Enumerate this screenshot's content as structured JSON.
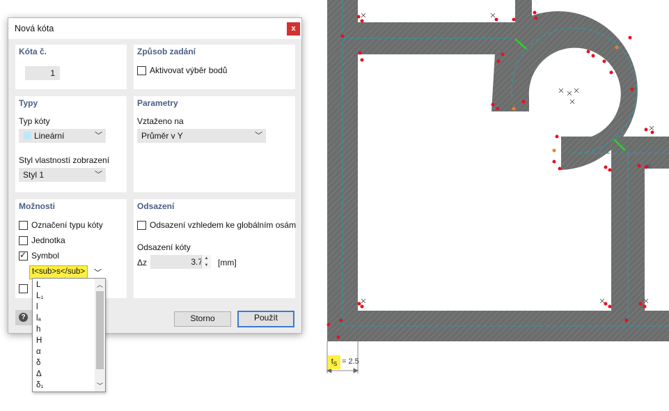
{
  "dialog": {
    "title": "Nová kóta",
    "close_label": "x",
    "kota_panel": {
      "header": "Kóta č.",
      "number": "1"
    },
    "zpusob_panel": {
      "header": "Způsob zadání",
      "activate_label": "Aktivovat výběr bodů",
      "activate_checked": false
    },
    "typy_panel": {
      "header": "Typy",
      "type_label": "Typ kóty",
      "type_value": "Lineární",
      "style_label": "Styl vlastností zobrazení",
      "style_value": "Styl 1"
    },
    "parametry_panel": {
      "header": "Parametry",
      "ref_label": "Vztaženo na",
      "ref_value": "Průměr v Y"
    },
    "moznosti_panel": {
      "header": "Možnosti",
      "options": [
        {
          "label": "Označení typu kóty",
          "checked": false
        },
        {
          "label": "Jednotka",
          "checked": false
        },
        {
          "label": "Symbol",
          "checked": true
        }
      ],
      "symbol_value": "t<sub>s</sub>"
    },
    "odsazeni_panel": {
      "header": "Odsazení",
      "global_label": "Odsazení vzhledem ke globálním osám",
      "global_checked": false,
      "offset_label": "Odsazení kóty",
      "delta_label": "Δz",
      "offset_value": "3.7",
      "unit": "[mm]"
    },
    "buttons": {
      "cancel": "Storno",
      "apply": "Použít",
      "help": "?"
    }
  },
  "symbol_dropdown": {
    "items": [
      "L",
      "L₁",
      "l",
      "lₐ",
      "h",
      "H",
      "α",
      "δ",
      "Δ",
      "δ₁"
    ]
  },
  "drawing": {
    "dimension_symbol": "t",
    "dimension_symbol_sub": "S",
    "dimension_value": "= 2.5"
  },
  "colors": {
    "section_fill": "#6b6d6d",
    "point_red": "#e8101e",
    "point_orange": "#f08020",
    "dimension_green": "#28d428",
    "centerline": "#2a9aa8",
    "symbol_highlight": "#ffef44",
    "close_button": "#d43030",
    "panel_header": "#4a5e86"
  }
}
